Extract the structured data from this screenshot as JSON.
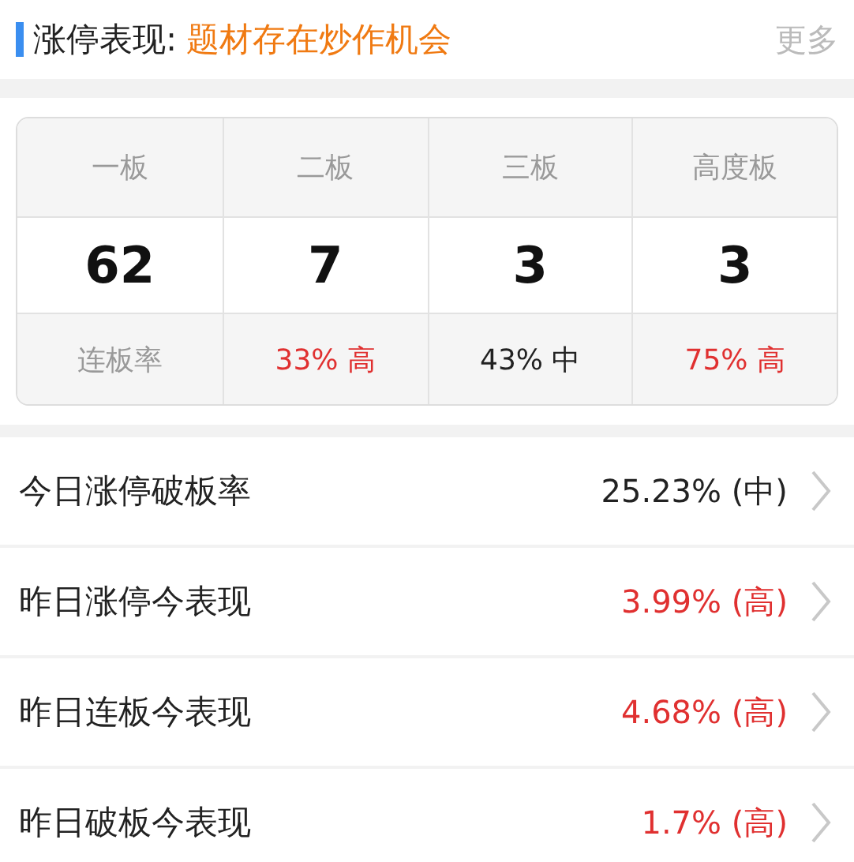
{
  "header": {
    "title": "涨停表现:",
    "highlight": "题材存在炒作机会",
    "more": "更多"
  },
  "table": {
    "columns": [
      "一板",
      "二板",
      "三板",
      "高度板"
    ],
    "counts": [
      "62",
      "7",
      "3",
      "3"
    ],
    "rates": [
      {
        "text": "连板率",
        "kind": "label"
      },
      {
        "text": "33% 高",
        "kind": "high"
      },
      {
        "text": "43% 中",
        "kind": "mid"
      },
      {
        "text": "75% 高",
        "kind": "high"
      }
    ]
  },
  "rows": [
    {
      "label": "今日涨停破板率",
      "value": "25.23% (中)",
      "kind": "mid"
    },
    {
      "label": "昨日涨停今表现",
      "value": "3.99% (高)",
      "kind": "high"
    },
    {
      "label": "昨日连板今表现",
      "value": "4.68% (高)",
      "kind": "high"
    },
    {
      "label": "昨日破板今表现",
      "value": "1.7% (高)",
      "kind": "high"
    }
  ]
}
